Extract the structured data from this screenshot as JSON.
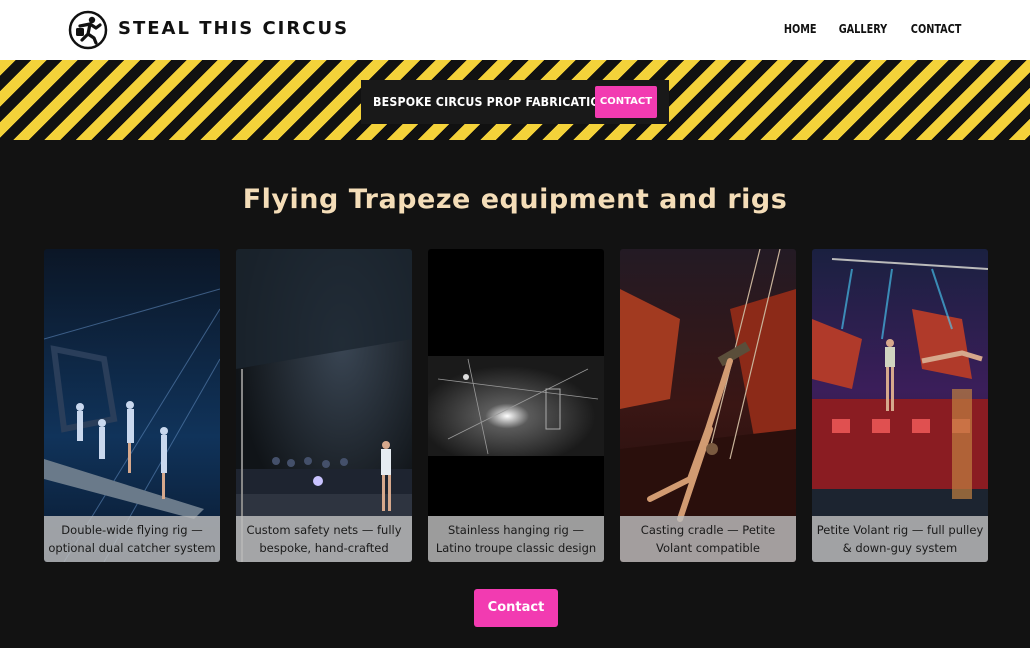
{
  "header": {
    "brand": "STEAL THIS CIRCUS",
    "logo_icon": "acrobat-logo-icon",
    "nav": [
      {
        "label": "HOME"
      },
      {
        "label": "GALLERY"
      },
      {
        "label": "CONTACT"
      }
    ]
  },
  "banner": {
    "text": "BESPOKE CIRCUS PROP FABRICATION",
    "button_label": "CONTACT"
  },
  "headline": "Flying Trapeze equipment and rigs",
  "cards": [
    {
      "caption": "Double-wide flying rig — optional dual catcher system"
    },
    {
      "caption": "Custom safety nets — fully bespoke, hand-crafted"
    },
    {
      "caption": "Stainless hanging rig — Latino troupe classic design"
    },
    {
      "caption": "Casting cradle — Petite Volant compatible"
    },
    {
      "caption": "Petite Volant rig — full pulley & down-guy system"
    }
  ],
  "cta_label": "Contact",
  "colors": {
    "accent_pink": "#f23bb1",
    "hazard_yellow": "#f4d23a",
    "headline": "#f4ddb8",
    "background": "#121212"
  }
}
